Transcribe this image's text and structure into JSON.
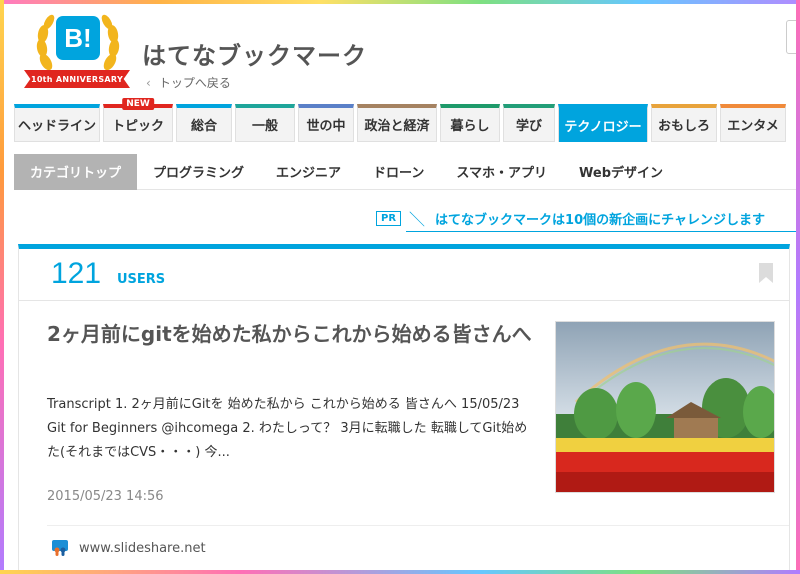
{
  "header": {
    "logo_text": "B!",
    "logo_ribbon": "10th ANNIVERSARY",
    "site_title": "はてなブックマーク",
    "back_link": "トップへ戻る"
  },
  "main_nav": [
    {
      "label": "ヘッドライン",
      "color": "#00a4de",
      "width": 86
    },
    {
      "label": "トピック",
      "color": "#e0261f",
      "width": 70,
      "badge": "NEW"
    },
    {
      "label": "総合",
      "color": "#00a4de",
      "width": 56
    },
    {
      "label": "一般",
      "color": "#1ea59a",
      "width": 60
    },
    {
      "label": "世の中",
      "color": "#5a80c8",
      "width": 56
    },
    {
      "label": "政治と経済",
      "color": "#a58261",
      "width": 80
    },
    {
      "label": "暮らし",
      "color": "#1e9a6a",
      "width": 60
    },
    {
      "label": "学び",
      "color": "#229e78",
      "width": 52
    },
    {
      "label": "テクノロジー",
      "color": "#00a4de",
      "width": 90,
      "active": true
    },
    {
      "label": "おもしろ",
      "color": "#e8a33b",
      "width": 66
    },
    {
      "label": "エンタメ",
      "color": "#f08a3a",
      "width": 66
    }
  ],
  "sub_nav": [
    {
      "label": "カテゴリトップ",
      "active": true
    },
    {
      "label": "プログラミング"
    },
    {
      "label": "エンジニア"
    },
    {
      "label": "ドローン"
    },
    {
      "label": "スマホ・アプリ"
    },
    {
      "label": "Webデザイン"
    }
  ],
  "pr": {
    "tag": "PR",
    "text": "はてなブックマークは10個の新企画にチャレンジします"
  },
  "entry": {
    "user_count": "121",
    "user_label": "USERS",
    "title": "2ヶ月前にgitを始めた私からこれから始める皆さんへ",
    "summary": "Transcript 1. 2ヶ月前にGitを 始めた私から これから始める 皆さんへ 15/05/23 Git for Beginners @ihcomega 2. わたしって？ 3月に転職した 転職してGit始めた(それまではCVS・・・) 今...",
    "date": "2015/05/23 14:56",
    "source": "www.slideshare.net"
  }
}
